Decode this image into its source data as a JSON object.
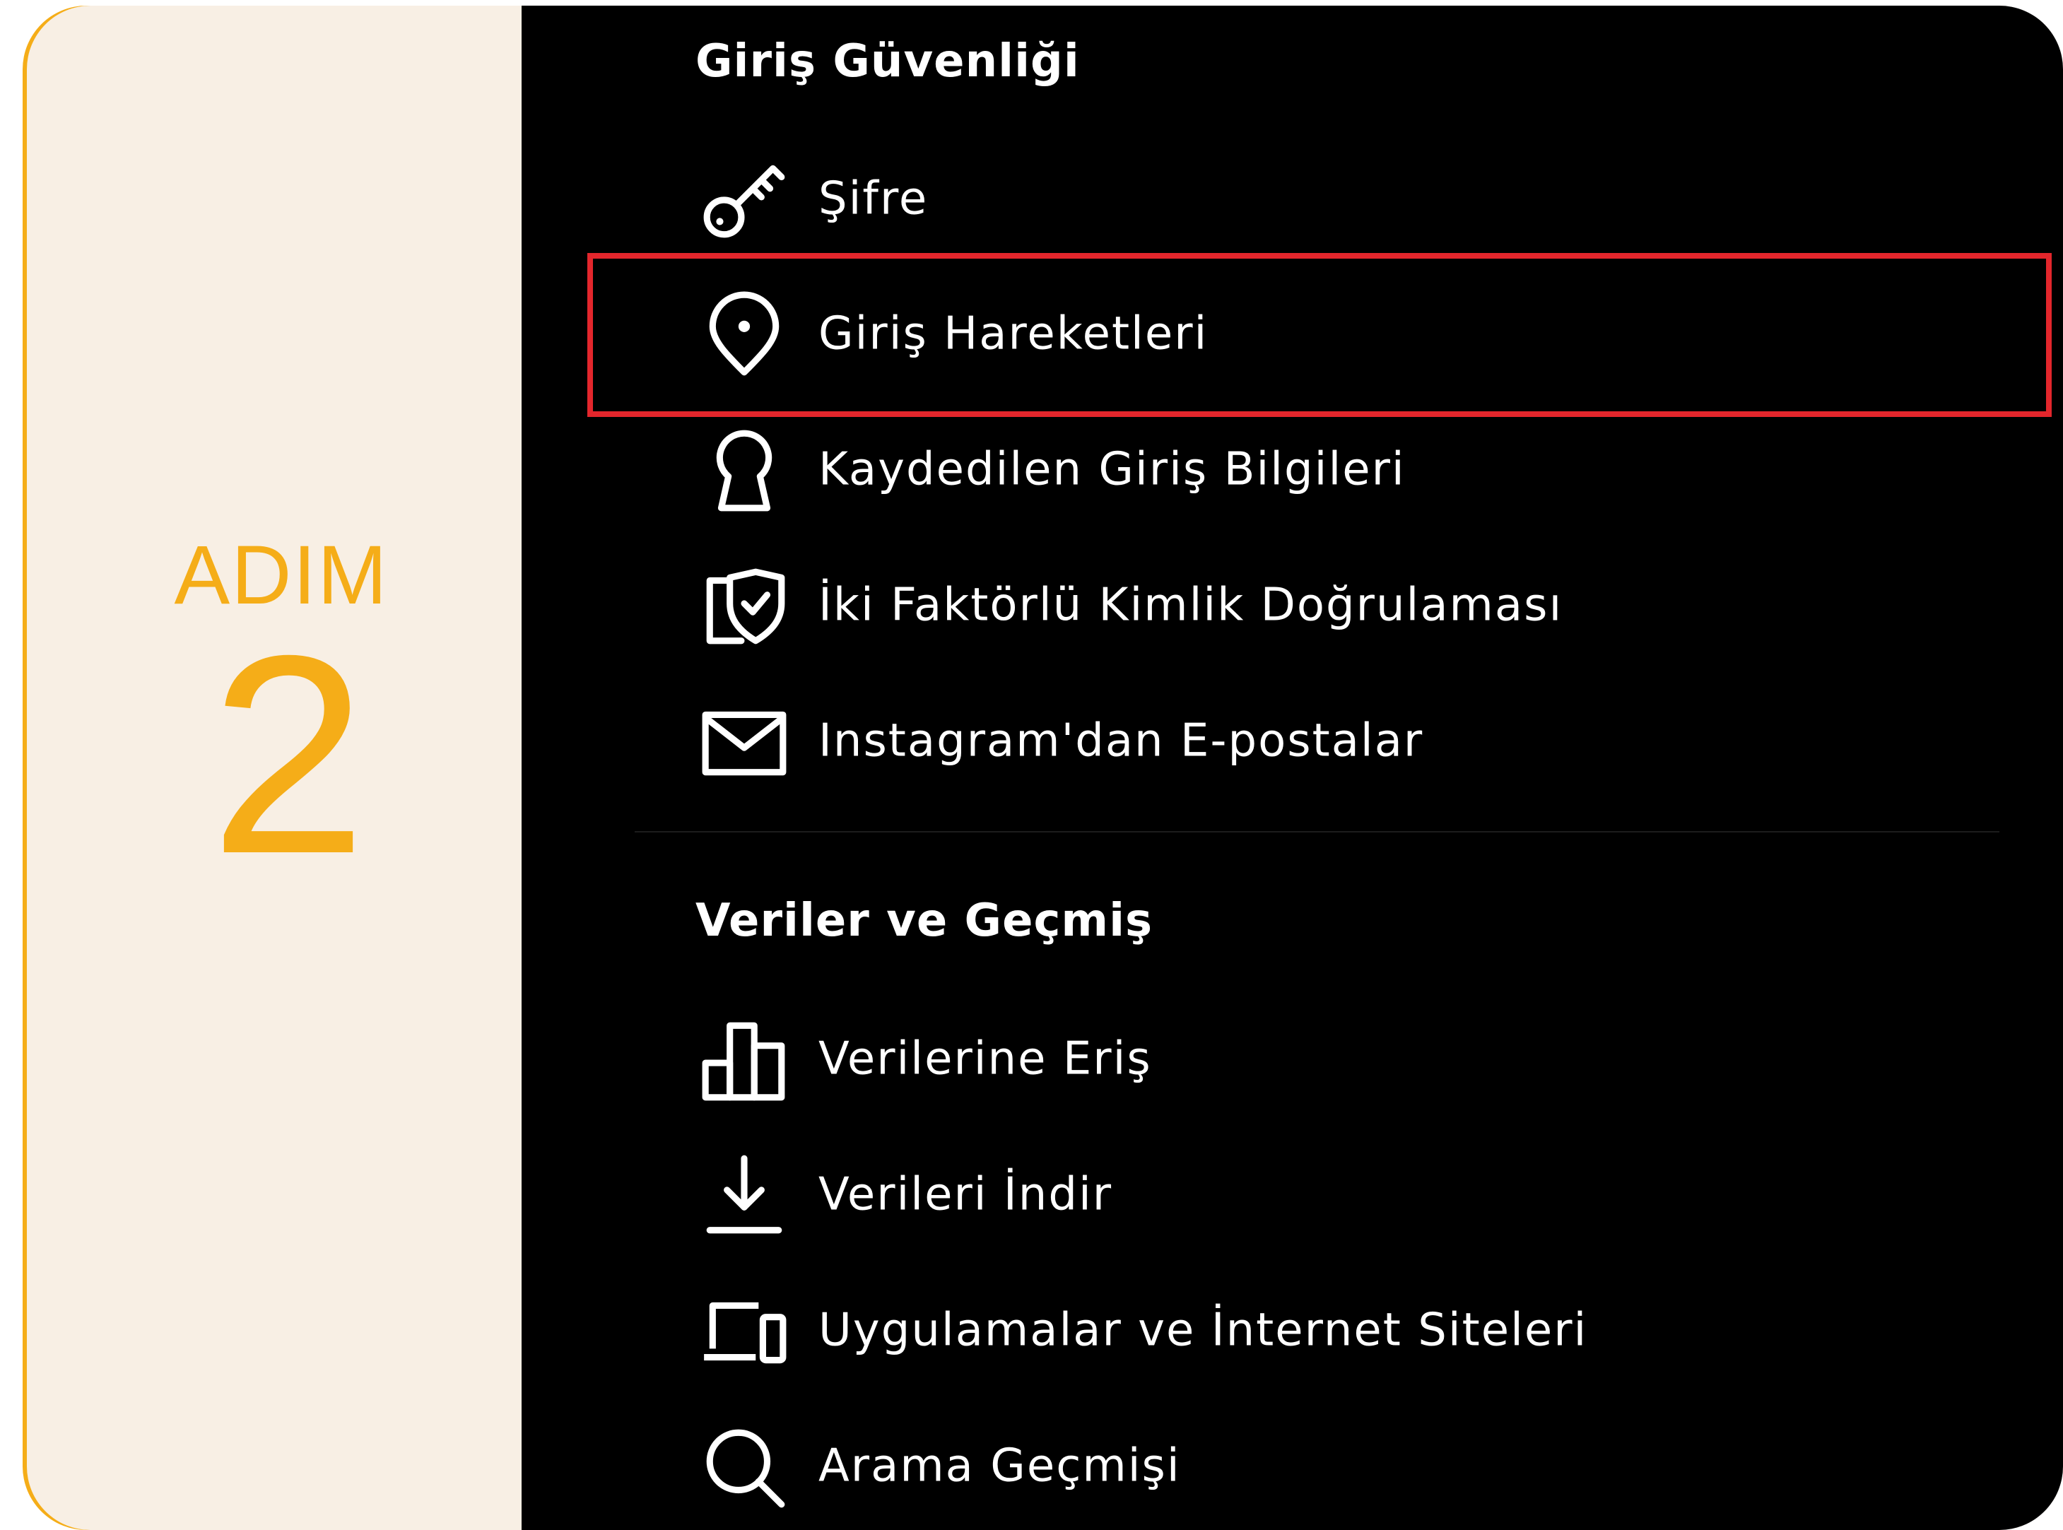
{
  "step": {
    "word": "ADIM",
    "number": "2"
  },
  "sections": {
    "login_security": {
      "title": "Giriş Güvenliği",
      "items": [
        {
          "label": "Şifre",
          "icon": "key-icon"
        },
        {
          "label": "Giriş Hareketleri",
          "icon": "location-pin-icon",
          "highlighted": true
        },
        {
          "label": "Kaydedilen Giriş Bilgileri",
          "icon": "keyhole-icon"
        },
        {
          "label": "İki Faktörlü Kimlik Doğrulaması",
          "icon": "shield-check-icon"
        },
        {
          "label": "Instagram'dan E-postalar",
          "icon": "envelope-icon"
        }
      ]
    },
    "data_history": {
      "title": "Veriler ve Geçmiş",
      "items": [
        {
          "label": "Verilerine Eriş",
          "icon": "bar-chart-icon"
        },
        {
          "label": "Verileri İndir",
          "icon": "download-icon"
        },
        {
          "label": "Uygulamalar ve İnternet Siteleri",
          "icon": "devices-icon"
        },
        {
          "label": "Arama Geçmişi",
          "icon": "search-icon"
        }
      ]
    }
  },
  "colors": {
    "accent": "#f5ad18",
    "highlight_border": "#e3262c",
    "panel_background": "#000000",
    "card_background": "#f8efe4"
  }
}
